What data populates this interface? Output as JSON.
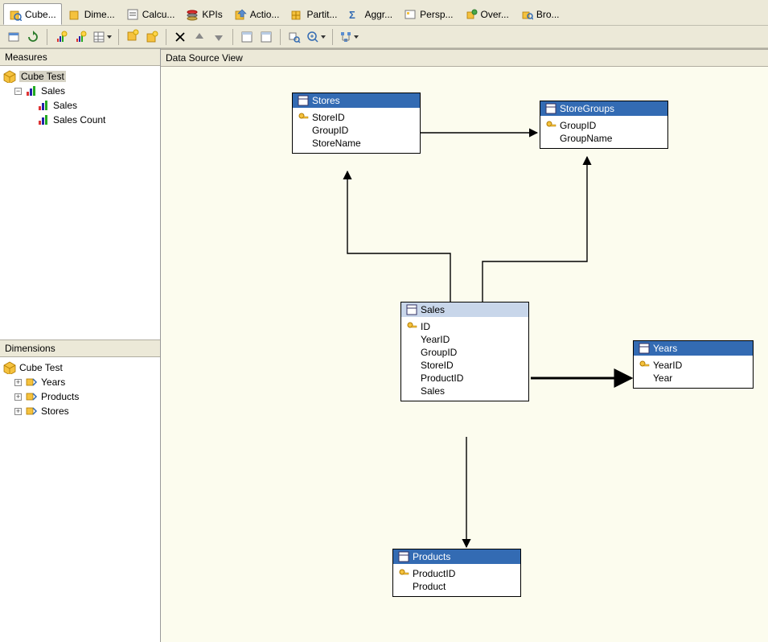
{
  "tabs": {
    "items": [
      {
        "label": "Cube...",
        "name": "tab-cube",
        "icon": "cube-search-icon",
        "active": true
      },
      {
        "label": "Dime...",
        "name": "tab-dimensions",
        "icon": "cube-dim-icon"
      },
      {
        "label": "Calcu...",
        "name": "tab-calculations",
        "icon": "calc-icon"
      },
      {
        "label": "KPIs",
        "name": "tab-kpis",
        "icon": "kpi-icon"
      },
      {
        "label": "Actio...",
        "name": "tab-actions",
        "icon": "action-icon"
      },
      {
        "label": "Partit...",
        "name": "tab-partitions",
        "icon": "partition-icon"
      },
      {
        "label": "Aggr...",
        "name": "tab-aggregations",
        "icon": "aggregation-icon"
      },
      {
        "label": "Persp...",
        "name": "tab-perspectives",
        "icon": "perspective-icon"
      },
      {
        "label": "Over...",
        "name": "tab-overview",
        "icon": "overview-icon"
      },
      {
        "label": "Bro...",
        "name": "tab-browser",
        "icon": "browser-icon"
      }
    ]
  },
  "measures": {
    "title": "Measures",
    "root": "Cube Test",
    "group": "Sales",
    "items": [
      {
        "label": "Sales"
      },
      {
        "label": "Sales Count"
      }
    ]
  },
  "dimensions": {
    "title": "Dimensions",
    "root": "Cube Test",
    "items": [
      {
        "label": "Years"
      },
      {
        "label": "Products"
      },
      {
        "label": "Stores"
      }
    ]
  },
  "dsv": {
    "title": "Data Source View",
    "tables": {
      "stores": {
        "name": "Stores",
        "columns": [
          {
            "label": "StoreID",
            "key": true
          },
          {
            "label": "GroupID"
          },
          {
            "label": "StoreName"
          }
        ]
      },
      "storeGroups": {
        "name": "StoreGroups",
        "columns": [
          {
            "label": "GroupID",
            "key": true
          },
          {
            "label": "GroupName"
          }
        ]
      },
      "sales": {
        "name": "Sales",
        "columns": [
          {
            "label": "ID",
            "key": true
          },
          {
            "label": "YearID"
          },
          {
            "label": "GroupID"
          },
          {
            "label": "StoreID"
          },
          {
            "label": "ProductID"
          },
          {
            "label": "Sales"
          }
        ]
      },
      "years": {
        "name": "Years",
        "columns": [
          {
            "label": "YearID",
            "key": true
          },
          {
            "label": "Year"
          }
        ]
      },
      "products": {
        "name": "Products",
        "columns": [
          {
            "label": "ProductID",
            "key": true
          },
          {
            "label": "Product"
          }
        ]
      }
    }
  }
}
